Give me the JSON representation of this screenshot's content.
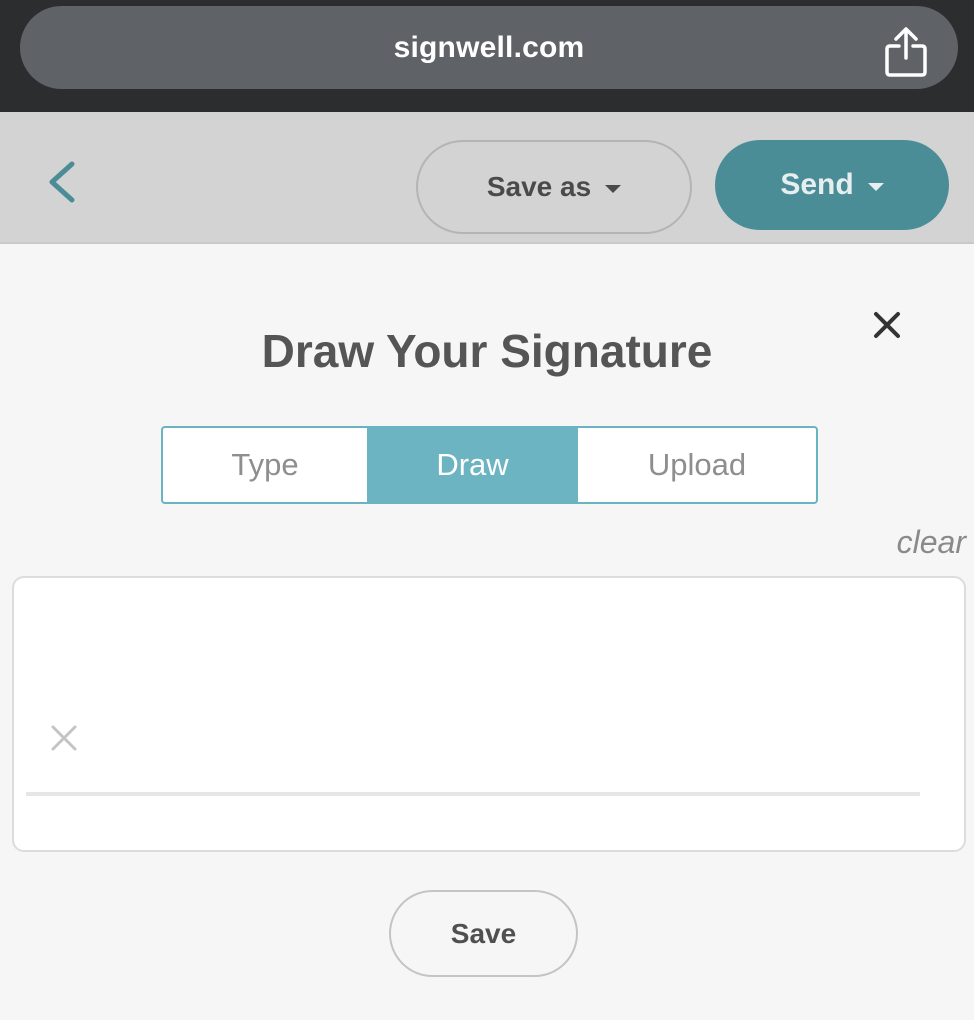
{
  "browser": {
    "url": "signwell.com",
    "share_icon": "share-icon"
  },
  "toolbar": {
    "back_icon": "chevron-left-icon",
    "save_as_label": "Save as",
    "send_label": "Send"
  },
  "modal": {
    "title": "Draw Your Signature",
    "close_icon": "close-icon",
    "tabs": [
      {
        "label": "Type",
        "active": false
      },
      {
        "label": "Draw",
        "active": true
      },
      {
        "label": "Upload",
        "active": false
      }
    ],
    "clear_label": "clear",
    "signature_marker_icon": "x-mark-icon",
    "save_label": "Save"
  },
  "colors": {
    "accent": "#6cb4c2",
    "send_button": "#4b8d97",
    "toolbar_bg": "#d3d3d3",
    "browser_bg": "#2c2d2f"
  }
}
